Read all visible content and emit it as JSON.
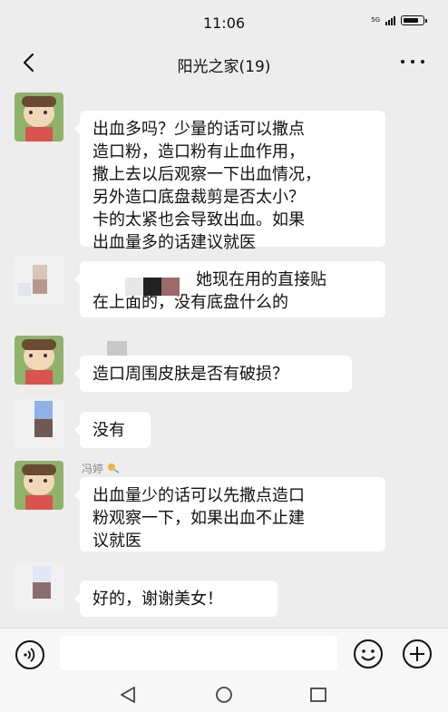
{
  "status_bar": {
    "time": "11:06",
    "network_label": "5G",
    "signal_level": 4,
    "battery_level": 0.85,
    "icons": [
      "signal-icon",
      "battery-icon"
    ]
  },
  "header": {
    "title": "阳光之家(19)",
    "icons": [
      "back-chevron-icon",
      "more-dots-icon"
    ]
  },
  "messages": [
    {
      "sender": "",
      "avatar": "cartoon",
      "lines": [
        "出血多吗？少量的话可以撒点",
        "造口粉，造口粉有止血作用，",
        "撒上去以后观察一下出血情况，",
        "另外造口底盘裁剪是否太小？",
        "卡的太紧也会导致出血。如果",
        "出血量多的话建议就医"
      ]
    },
    {
      "sender": "",
      "avatar": "blurred",
      "lines": [
        "她现在用的直接贴",
        "在上面的，没有底盘什么的"
      ]
    },
    {
      "sender": "",
      "avatar": "cartoon",
      "lines": [
        "造口周围皮肤是否有破损？"
      ]
    },
    {
      "sender": "",
      "avatar": "blurred",
      "lines": [
        "没有"
      ]
    },
    {
      "sender": "冯婷",
      "avatar": "cartoon",
      "lines": [
        "出血量少的话可以先撒点造口",
        "粉观察一下，如果出血不止建",
        "议就医"
      ]
    },
    {
      "sender": "",
      "avatar": "blurred",
      "lines": [
        "好的，谢谢美女！"
      ]
    }
  ],
  "input_bar": {
    "value": "",
    "icons": [
      "voice-icon",
      "emoji-icon",
      "plus-icon"
    ]
  },
  "nav_bar": {
    "icons": [
      "nav-back-icon",
      "nav-home-icon",
      "nav-recent-icon"
    ]
  },
  "colors": {
    "background": "#ededed",
    "bubble": "#ffffff",
    "text": "#111111",
    "sender": "#888888",
    "avatar_green": "#8fb36b"
  }
}
